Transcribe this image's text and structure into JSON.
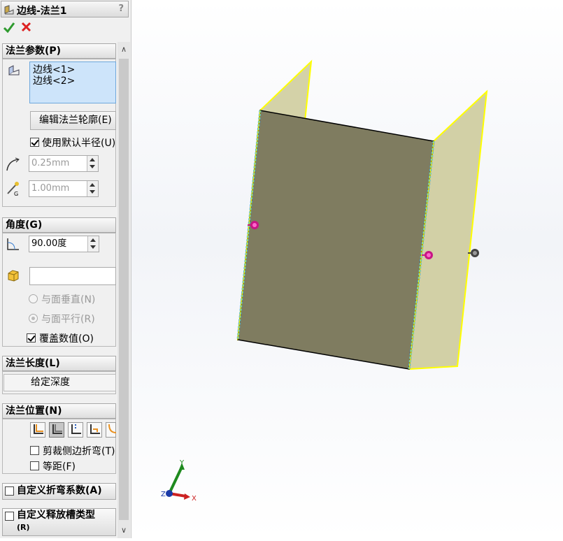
{
  "panel": {
    "title": "边线-法兰1",
    "help": "?",
    "ok_icon": "checkmark-icon",
    "cancel_icon": "x-icon"
  },
  "flange_params": {
    "header": "法兰参数(P)",
    "edges": [
      "边线<1>",
      "边线<2>"
    ],
    "edit_profile_button": "编辑法兰轮廓(E)",
    "use_default_radius": {
      "label": "使用默认半径(U)",
      "checked": true
    },
    "radius": "0.25mm",
    "gap": "1.00mm"
  },
  "angle": {
    "header": "角度(G)",
    "value": "90.00度",
    "face_field": "",
    "normal_to_face": "与面垂直(N)",
    "parallel_to_face": "与面平行(R)",
    "override_value": {
      "label": "覆盖数值(O)",
      "checked": true
    }
  },
  "flange_length": {
    "header": "法兰长度(L)",
    "end_condition": "给定深度"
  },
  "flange_position": {
    "header": "法兰位置(N)",
    "trim_side_bends": {
      "label": "剪裁侧边折弯(T)",
      "checked": false
    },
    "offset": {
      "label": "等距(F)",
      "checked": false
    }
  },
  "custom_bend_allowance": {
    "label": "自定义折弯系数(A)",
    "checked": false
  },
  "custom_relief_type": {
    "label": "自定义释放槽类型",
    "label2": "(R)",
    "checked": false
  },
  "triad": {
    "x": "X",
    "y": "Y",
    "z": "Z"
  },
  "colors": {
    "accent": "#c8d7ee",
    "flange_edge": "#ffff00",
    "face": "#7f7c60",
    "flange_face": "#d0cfa8"
  }
}
